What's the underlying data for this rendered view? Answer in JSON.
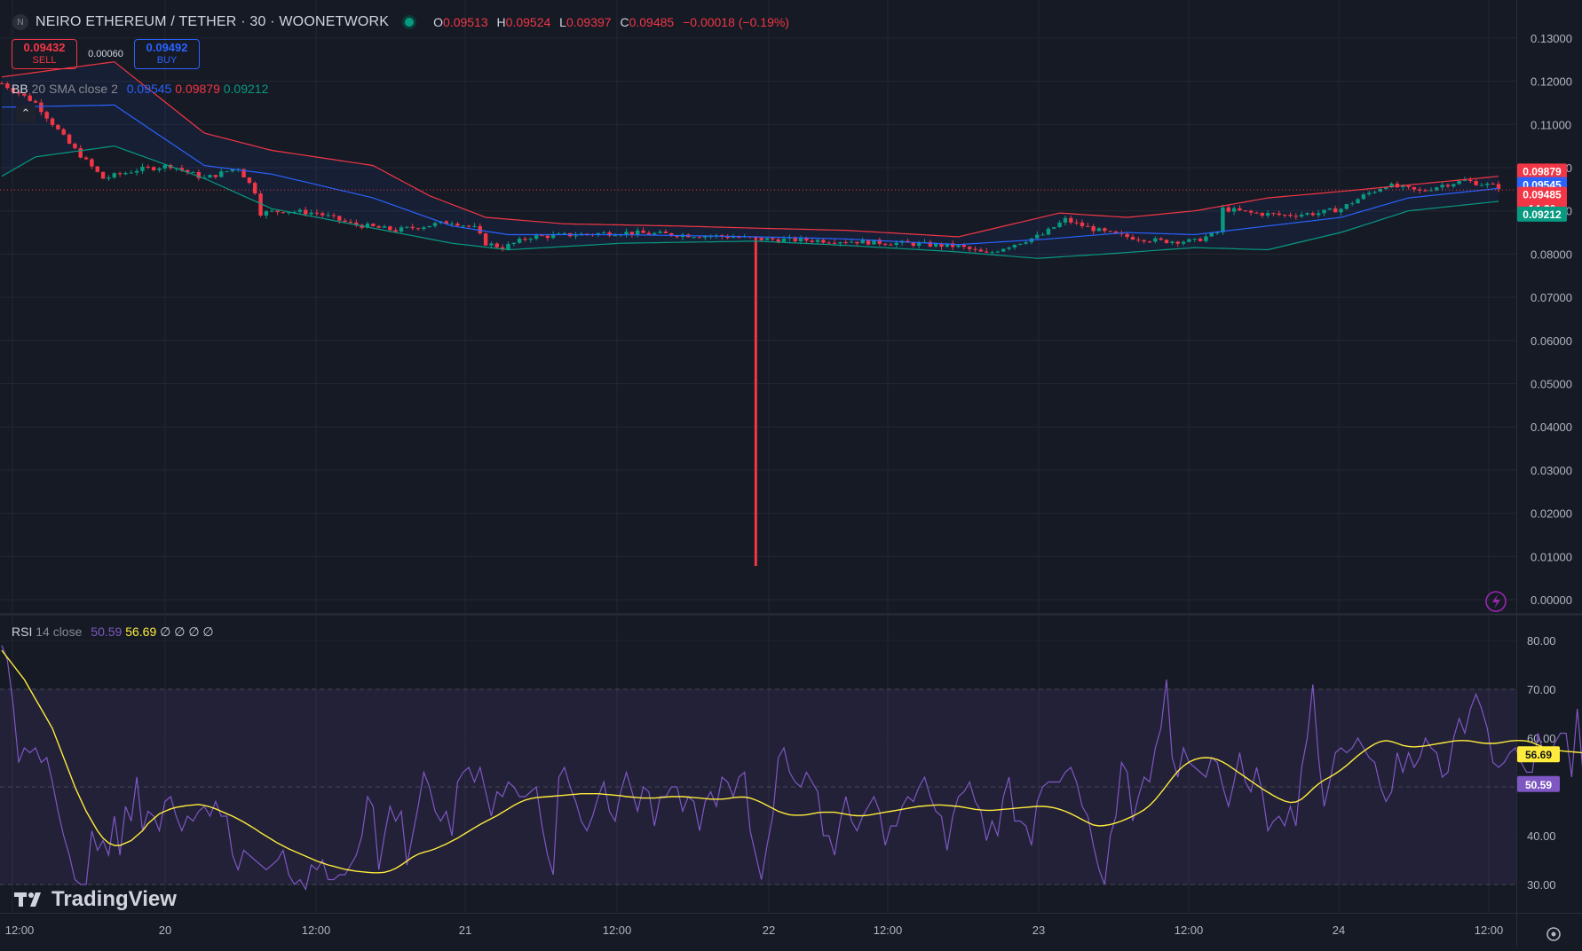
{
  "header": {
    "symbol_icon": "N",
    "title": "NEIRO ETHEREUM / TETHER · 30 · WOONETWORK",
    "ohlc": [
      {
        "key": "O",
        "value": "0.09513"
      },
      {
        "key": "H",
        "value": "0.09524"
      },
      {
        "key": "L",
        "value": "0.09397"
      },
      {
        "key": "C",
        "value": "0.09485"
      },
      {
        "key": "",
        "value": "−0.00018 (−0.19%)"
      }
    ]
  },
  "trade": {
    "sell_price": "0.09432",
    "sell_label": "SELL",
    "spread": "0.00060",
    "buy_price": "0.09492",
    "buy_label": "BUY"
  },
  "bb_legend": {
    "name": "BB",
    "params": "20 SMA close 2",
    "basis": "0.09545",
    "upper": "0.09879",
    "lower": "0.09212"
  },
  "rsi_legend": {
    "name": "RSI",
    "params": "14 close",
    "rsi": "50.59",
    "ma": "56.69",
    "extra": "∅ ∅ ∅ ∅"
  },
  "logo_text": "TradingView",
  "colors": {
    "background": "#161a25",
    "up": "#089981",
    "down": "#f23645",
    "bb_upper": "#f23645",
    "bb_basis": "#2962ff",
    "bb_lower": "#089981",
    "rsi": "#7e57c2",
    "rsi_ma": "#ffeb3b",
    "grid": "#242733",
    "text": "#b2b5be"
  },
  "icons": {
    "collapse": "chevron-up-icon",
    "flash": "lightning-icon",
    "settings": "gear-icon",
    "logo": "tradingview-logo-icon"
  },
  "chart_data": [
    {
      "type": "candlestick",
      "title": "NEIRO ETHEREUM / TETHER · 30 · WOONETWORK",
      "ylim": [
        0,
        0.13
      ],
      "y_ticks": [
        "0.13000",
        "0.12000",
        "0.11000",
        "0.10000",
        "0.09000",
        "0.08000",
        "0.07000",
        "0.06000",
        "0.05000",
        "0.04000",
        "0.03000",
        "0.02000",
        "0.01000",
        "0.00000"
      ],
      "x_tick_labels": [
        "12:00",
        "20",
        "12:00",
        "21",
        "12:00",
        "22",
        "12:00",
        "23",
        "12:00",
        "24",
        "12:00"
      ],
      "grid": true,
      "price_labels": {
        "upper": "0.09879",
        "basis": "0.09545",
        "last": "0.09485",
        "countdown": "14:20",
        "lower": "0.09212"
      },
      "close_path": [
        [
          0,
          0.1195
        ],
        [
          6,
          0.115
        ],
        [
          12,
          0.1055
        ],
        [
          18,
          0.0975
        ],
        [
          24,
          0.0995
        ],
        [
          30,
          0.1005
        ],
        [
          36,
          0.0975
        ],
        [
          42,
          0.1
        ],
        [
          45,
          0.0945
        ],
        [
          46,
          0.0895
        ],
        [
          50,
          0.09
        ],
        [
          56,
          0.0895
        ],
        [
          62,
          0.087
        ],
        [
          70,
          0.0855
        ],
        [
          80,
          0.0875
        ],
        [
          84,
          0.086
        ],
        [
          86,
          0.0825
        ],
        [
          89,
          0.0815
        ],
        [
          94,
          0.084
        ],
        [
          110,
          0.085
        ],
        [
          130,
          0.084
        ],
        [
          134,
          0.0835
        ],
        [
          150,
          0.083
        ],
        [
          160,
          0.0825
        ],
        [
          170,
          0.0818
        ],
        [
          175,
          0.08
        ],
        [
          178,
          0.0815
        ],
        [
          185,
          0.0845
        ],
        [
          189,
          0.088
        ],
        [
          191,
          0.087
        ],
        [
          196,
          0.085
        ],
        [
          200,
          0.084
        ],
        [
          206,
          0.083
        ],
        [
          212,
          0.083
        ],
        [
          216,
          0.085
        ],
        [
          217,
          0.0905
        ],
        [
          222,
          0.0895
        ],
        [
          228,
          0.089
        ],
        [
          234,
          0.0895
        ],
        [
          238,
          0.0905
        ],
        [
          242,
          0.0935
        ],
        [
          246,
          0.096
        ],
        [
          252,
          0.0945
        ],
        [
          256,
          0.096
        ],
        [
          260,
          0.097
        ],
        [
          266,
          0.0955
        ]
      ],
      "spike_low": {
        "index": 134,
        "value": 0.0078
      },
      "series": [
        {
          "name": "BB",
          "path": [
            [
              0,
              0.121
            ],
            [
              20,
              0.1245
            ],
            [
              36,
              0.108
            ],
            [
              48,
              0.104
            ],
            [
              66,
              0.1005
            ],
            [
              76,
              0.0935
            ],
            [
              86,
              0.0885
            ],
            [
              100,
              0.087
            ],
            [
              120,
              0.0865
            ],
            [
              134,
              0.086
            ],
            [
              150,
              0.0855
            ],
            [
              170,
              0.084
            ],
            [
              188,
              0.0895
            ],
            [
              200,
              0.0885
            ],
            [
              212,
              0.09
            ],
            [
              225,
              0.093
            ],
            [
              238,
              0.0945
            ],
            [
              250,
              0.096
            ],
            [
              266,
              0.098
            ]
          ]
        },
        {
          "name": "BB",
          "path": [
            [
              0,
              0.114
            ],
            [
              20,
              0.1145
            ],
            [
              36,
              0.1005
            ],
            [
              48,
              0.0985
            ],
            [
              66,
              0.093
            ],
            [
              80,
              0.0865
            ],
            [
              90,
              0.0845
            ],
            [
              110,
              0.0845
            ],
            [
              134,
              0.084
            ],
            [
              150,
              0.0835
            ],
            [
              170,
              0.0822
            ],
            [
              186,
              0.0835
            ],
            [
              200,
              0.085
            ],
            [
              212,
              0.0845
            ],
            [
              225,
              0.0865
            ],
            [
              238,
              0.0885
            ],
            [
              250,
              0.093
            ],
            [
              266,
              0.0952
            ]
          ]
        },
        {
          "name": "BB",
          "path": [
            [
              0,
              0.098
            ],
            [
              6,
              0.1025
            ],
            [
              20,
              0.105
            ],
            [
              36,
              0.0975
            ],
            [
              48,
              0.0905
            ],
            [
              66,
              0.086
            ],
            [
              80,
              0.0825
            ],
            [
              90,
              0.081
            ],
            [
              110,
              0.0825
            ],
            [
              134,
              0.083
            ],
            [
              150,
              0.082
            ],
            [
              170,
              0.0805
            ],
            [
              184,
              0.079
            ],
            [
              196,
              0.08
            ],
            [
              212,
              0.0815
            ],
            [
              225,
              0.081
            ],
            [
              238,
              0.085
            ],
            [
              250,
              0.09
            ],
            [
              266,
              0.0922
            ]
          ]
        }
      ]
    },
    {
      "type": "line",
      "title": "RSI 14 close",
      "ylim": [
        25,
        85
      ],
      "y_ticks": [
        "80.00",
        "70.00",
        "60.00",
        "50.00",
        "40.00",
        "30.00"
      ],
      "bands": {
        "upper": 70,
        "middle": 50,
        "lower": 30
      },
      "price_labels": {
        "ma": "56.69",
        "rsi": "50.59"
      },
      "series": [
        {
          "name": "RSI",
          "values": [
            79,
            76,
            67,
            55,
            58,
            57,
            58,
            55,
            56,
            51,
            45,
            40,
            36,
            31,
            30,
            30,
            41,
            37,
            39,
            36,
            44,
            36,
            46,
            43,
            52,
            41,
            45,
            44,
            41,
            47,
            48,
            44,
            41,
            44,
            43,
            45,
            46,
            44,
            47,
            44,
            44,
            36,
            33,
            37,
            36,
            35,
            34,
            33,
            34,
            35,
            37,
            32,
            30,
            31,
            29,
            34,
            33,
            35,
            31,
            31,
            32,
            32,
            34,
            36,
            40,
            48,
            46,
            33,
            40,
            46,
            43,
            45,
            34,
            40,
            46,
            53,
            50,
            45,
            43,
            45,
            40,
            51,
            53,
            54,
            51,
            54,
            49,
            44,
            49,
            48,
            51,
            50,
            48,
            48,
            49,
            50,
            42,
            36,
            32,
            52,
            54,
            50,
            47,
            43,
            41,
            44,
            48,
            51,
            45,
            43,
            49,
            53,
            49,
            45,
            50,
            49,
            42,
            48,
            48,
            50,
            50,
            45,
            48,
            47,
            41,
            47,
            49,
            46,
            52,
            51,
            48,
            52,
            53,
            41,
            36,
            31,
            38,
            44,
            56,
            58,
            53,
            51,
            50,
            53,
            51,
            49,
            40,
            40,
            36,
            43,
            48,
            43,
            41,
            44,
            46,
            48,
            45,
            38,
            42,
            42,
            46,
            48,
            47,
            50,
            52,
            48,
            45,
            44,
            37,
            44,
            48,
            49,
            51,
            47,
            45,
            39,
            43,
            40,
            48,
            52,
            43,
            43,
            42,
            38,
            47,
            50,
            51,
            51,
            51,
            53,
            54,
            51,
            46,
            44,
            38,
            33,
            30,
            40,
            44,
            55,
            53,
            43,
            48,
            52,
            51,
            58,
            62,
            72,
            56,
            52,
            58,
            55,
            54,
            53,
            52,
            56,
            55,
            50,
            46,
            51,
            57,
            51,
            49,
            54,
            49,
            41,
            43,
            44,
            42,
            46,
            42,
            54,
            60,
            71,
            56,
            46,
            51,
            57,
            58,
            57,
            58,
            60,
            58,
            56,
            55,
            50,
            47,
            49,
            57,
            53,
            57,
            54,
            56,
            60,
            58,
            57,
            52,
            53,
            60,
            64,
            61,
            66,
            69,
            66,
            62,
            55,
            54,
            55,
            57,
            58,
            55,
            53,
            53,
            61,
            57,
            56,
            59,
            61,
            61,
            52,
            66,
            53,
            51,
            52,
            51
          ]
        },
        {
          "name": "RSI MA",
          "values": [
            78,
            76.5,
            75,
            73.5,
            72,
            70,
            68,
            66,
            64,
            62,
            59,
            56,
            53,
            50,
            47.5,
            45,
            43,
            41,
            39.5,
            38.5,
            38,
            38,
            38.5,
            39,
            40,
            41,
            42.5,
            43.5,
            44.5,
            45,
            45.5,
            45.8,
            46,
            46.2,
            46.3,
            46.4,
            46.2,
            45.9,
            45.5,
            45,
            44.5,
            44,
            43.4,
            42.8,
            42.1,
            41.4,
            40.6,
            39.9,
            39.2,
            38.5,
            37.9,
            37.3,
            36.8,
            36.3,
            35.8,
            35.3,
            34.8,
            34.4,
            34,
            33.7,
            33.4,
            33.1,
            32.9,
            32.7,
            32.6,
            32.5,
            32.4,
            32.4,
            32.5,
            32.8,
            33.3,
            34,
            34.8,
            35.6,
            36.2,
            36.6,
            36.9,
            37.3,
            37.8,
            38.3,
            38.9,
            39.5,
            40.2,
            40.9,
            41.6,
            42.3,
            42.9,
            43.5,
            44.1,
            44.8,
            45.5,
            46.2,
            46.8,
            47.3,
            47.6,
            47.8,
            47.9,
            48,
            48.1,
            48.2,
            48.3,
            48.4,
            48.5,
            48.6,
            48.6,
            48.6,
            48.6,
            48.5,
            48.4,
            48.3,
            48.2,
            48,
            47.9,
            47.8,
            47.7,
            47.7,
            47.7,
            47.8,
            47.9,
            48,
            48,
            48,
            47.9,
            47.8,
            47.7,
            47.6,
            47.5,
            47.5,
            47.5,
            47.6,
            47.8,
            47.9,
            47.9,
            47.7,
            47.3,
            46.8,
            46.2,
            45.6,
            45,
            44.6,
            44.3,
            44.2,
            44.2,
            44.3,
            44.5,
            44.7,
            44.8,
            44.8,
            44.8,
            44.6,
            44.4,
            44.2,
            44.1,
            44.1,
            44.2,
            44.4,
            44.6,
            44.8,
            45,
            45.2,
            45.4,
            45.6,
            45.8,
            46,
            46.1,
            46.2,
            46.3,
            46.3,
            46.2,
            46.1,
            46,
            45.8,
            45.6,
            45.4,
            45.3,
            45.2,
            45.2,
            45.3,
            45.4,
            45.5,
            45.6,
            45.7,
            45.8,
            45.9,
            46,
            46,
            45.9,
            45.7,
            45.4,
            45,
            44.5,
            43.9,
            43.3,
            42.7,
            42.2,
            42,
            42.1,
            42.3,
            42.6,
            43,
            43.5,
            44,
            44.6,
            45.3,
            46.2,
            47.4,
            48.8,
            50.3,
            51.8,
            53.2,
            54.3,
            55.1,
            55.6,
            55.9,
            56,
            55.9,
            55.6,
            55.1,
            54.4,
            53.6,
            52.8,
            52,
            51.2,
            50.4,
            49.6,
            48.9,
            48.2,
            47.6,
            47.1,
            46.8,
            46.9,
            47.5,
            48.5,
            49.6,
            50.6,
            51.4,
            52,
            52.7,
            53.5,
            54.4,
            55.4,
            56.4,
            57.3,
            58.1,
            58.8,
            59.3,
            59.5,
            59.3,
            58.9,
            58.5,
            58.3,
            58.2,
            58.3,
            58.4,
            58.6,
            58.8,
            59,
            59.2,
            59.4,
            59.5,
            59.5,
            59.4,
            59.2,
            59,
            58.9,
            58.9,
            59,
            59.2,
            59.4,
            59.5,
            59.5,
            59.4,
            59.1,
            58.6,
            58.1,
            57.7,
            57.5,
            57.4,
            57.3,
            57.2,
            57.1,
            57,
            56.8,
            56.7
          ]
        }
      ]
    }
  ]
}
